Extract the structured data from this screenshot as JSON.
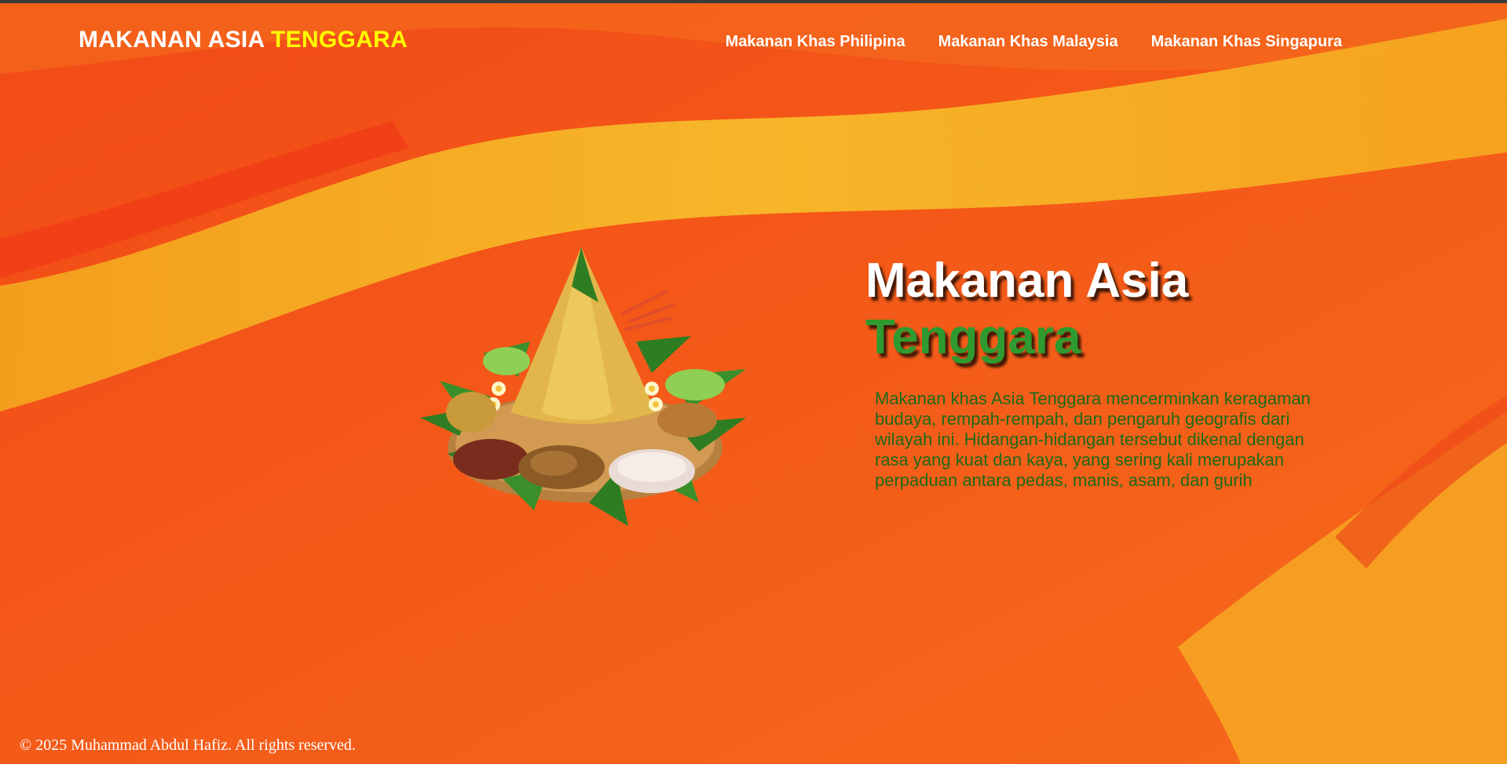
{
  "header": {
    "logo_main": "MAKANAN ASIA",
    "logo_accent": "TENGGARA",
    "nav": [
      {
        "label": "Makanan Khas Philipina"
      },
      {
        "label": "Makanan Khas Malaysia"
      },
      {
        "label": "Makanan Khas Singapura"
      }
    ]
  },
  "hero": {
    "title_line1": "Makanan Asia",
    "title_line2": "Tenggara",
    "description": "Makanan khas Asia Tenggara mencerminkan keragaman budaya, rempah-rempah, dan pengaruh geografis dari wilayah ini. Hidangan-hidangan tersebut dikenal dengan rasa yang kuat dan kaya, yang sering kali merupakan perpaduan antara pedas, manis, asam, dan gurih",
    "image": "tumpeng-illustration"
  },
  "footer": {
    "copyright": "© 2025 Muhammad Abdul Hafiz. All rights reserved."
  },
  "colors": {
    "background": "#f4561a",
    "wave_yellow": "#f5b21c",
    "logo_accent": "#ffff00",
    "title_accent": "#2e9a2f",
    "description_text": "#1c6a18"
  }
}
